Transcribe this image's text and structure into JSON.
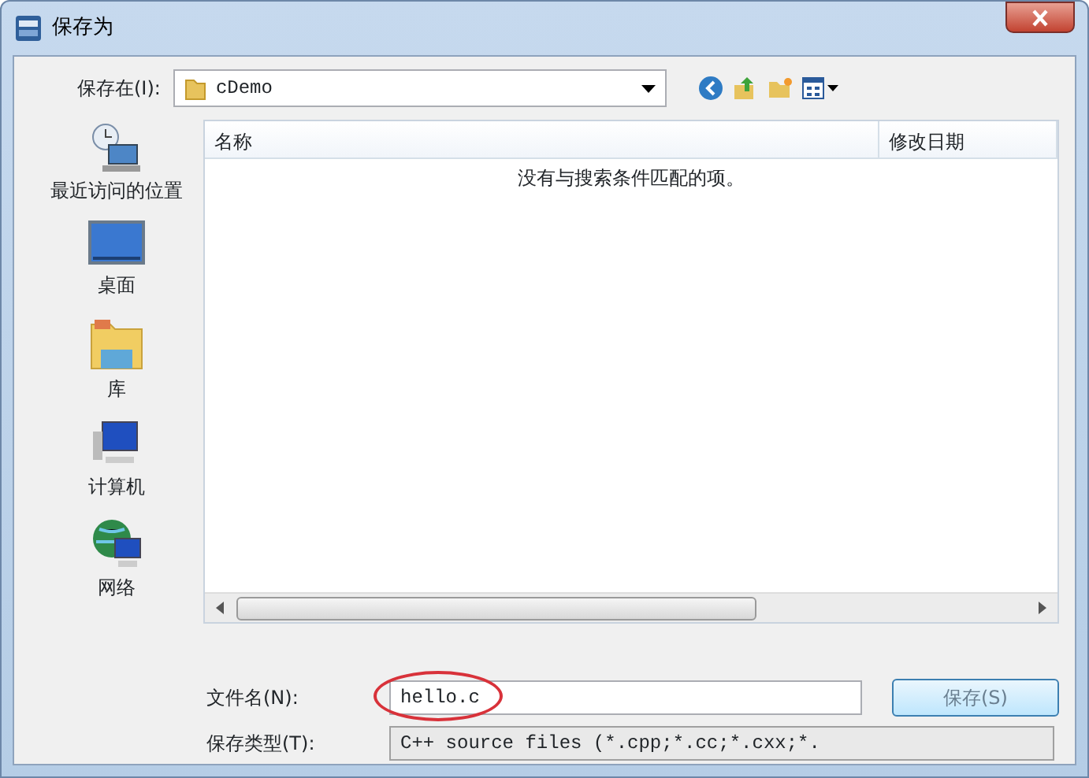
{
  "window": {
    "title": "保存为"
  },
  "location": {
    "label": "保存在(I):",
    "value": "cDemo"
  },
  "sidebar": {
    "items": [
      {
        "label": "最近访问的位置",
        "kind": "recent"
      },
      {
        "label": "桌面",
        "kind": "desktop"
      },
      {
        "label": "库",
        "kind": "library"
      },
      {
        "label": "计算机",
        "kind": "computer"
      },
      {
        "label": "网络",
        "kind": "network"
      }
    ]
  },
  "table": {
    "columns": [
      "名称",
      "修改日期"
    ],
    "empty_message": "没有与搜索条件匹配的项。"
  },
  "file_name": {
    "label": "文件名(N):",
    "value": "hello.c",
    "highlighted": true
  },
  "file_type": {
    "label": "保存类型(T):",
    "value": "C++ source files (*.cpp;*.cc;*.cxx;*."
  },
  "buttons": [
    "保存(S)"
  ]
}
